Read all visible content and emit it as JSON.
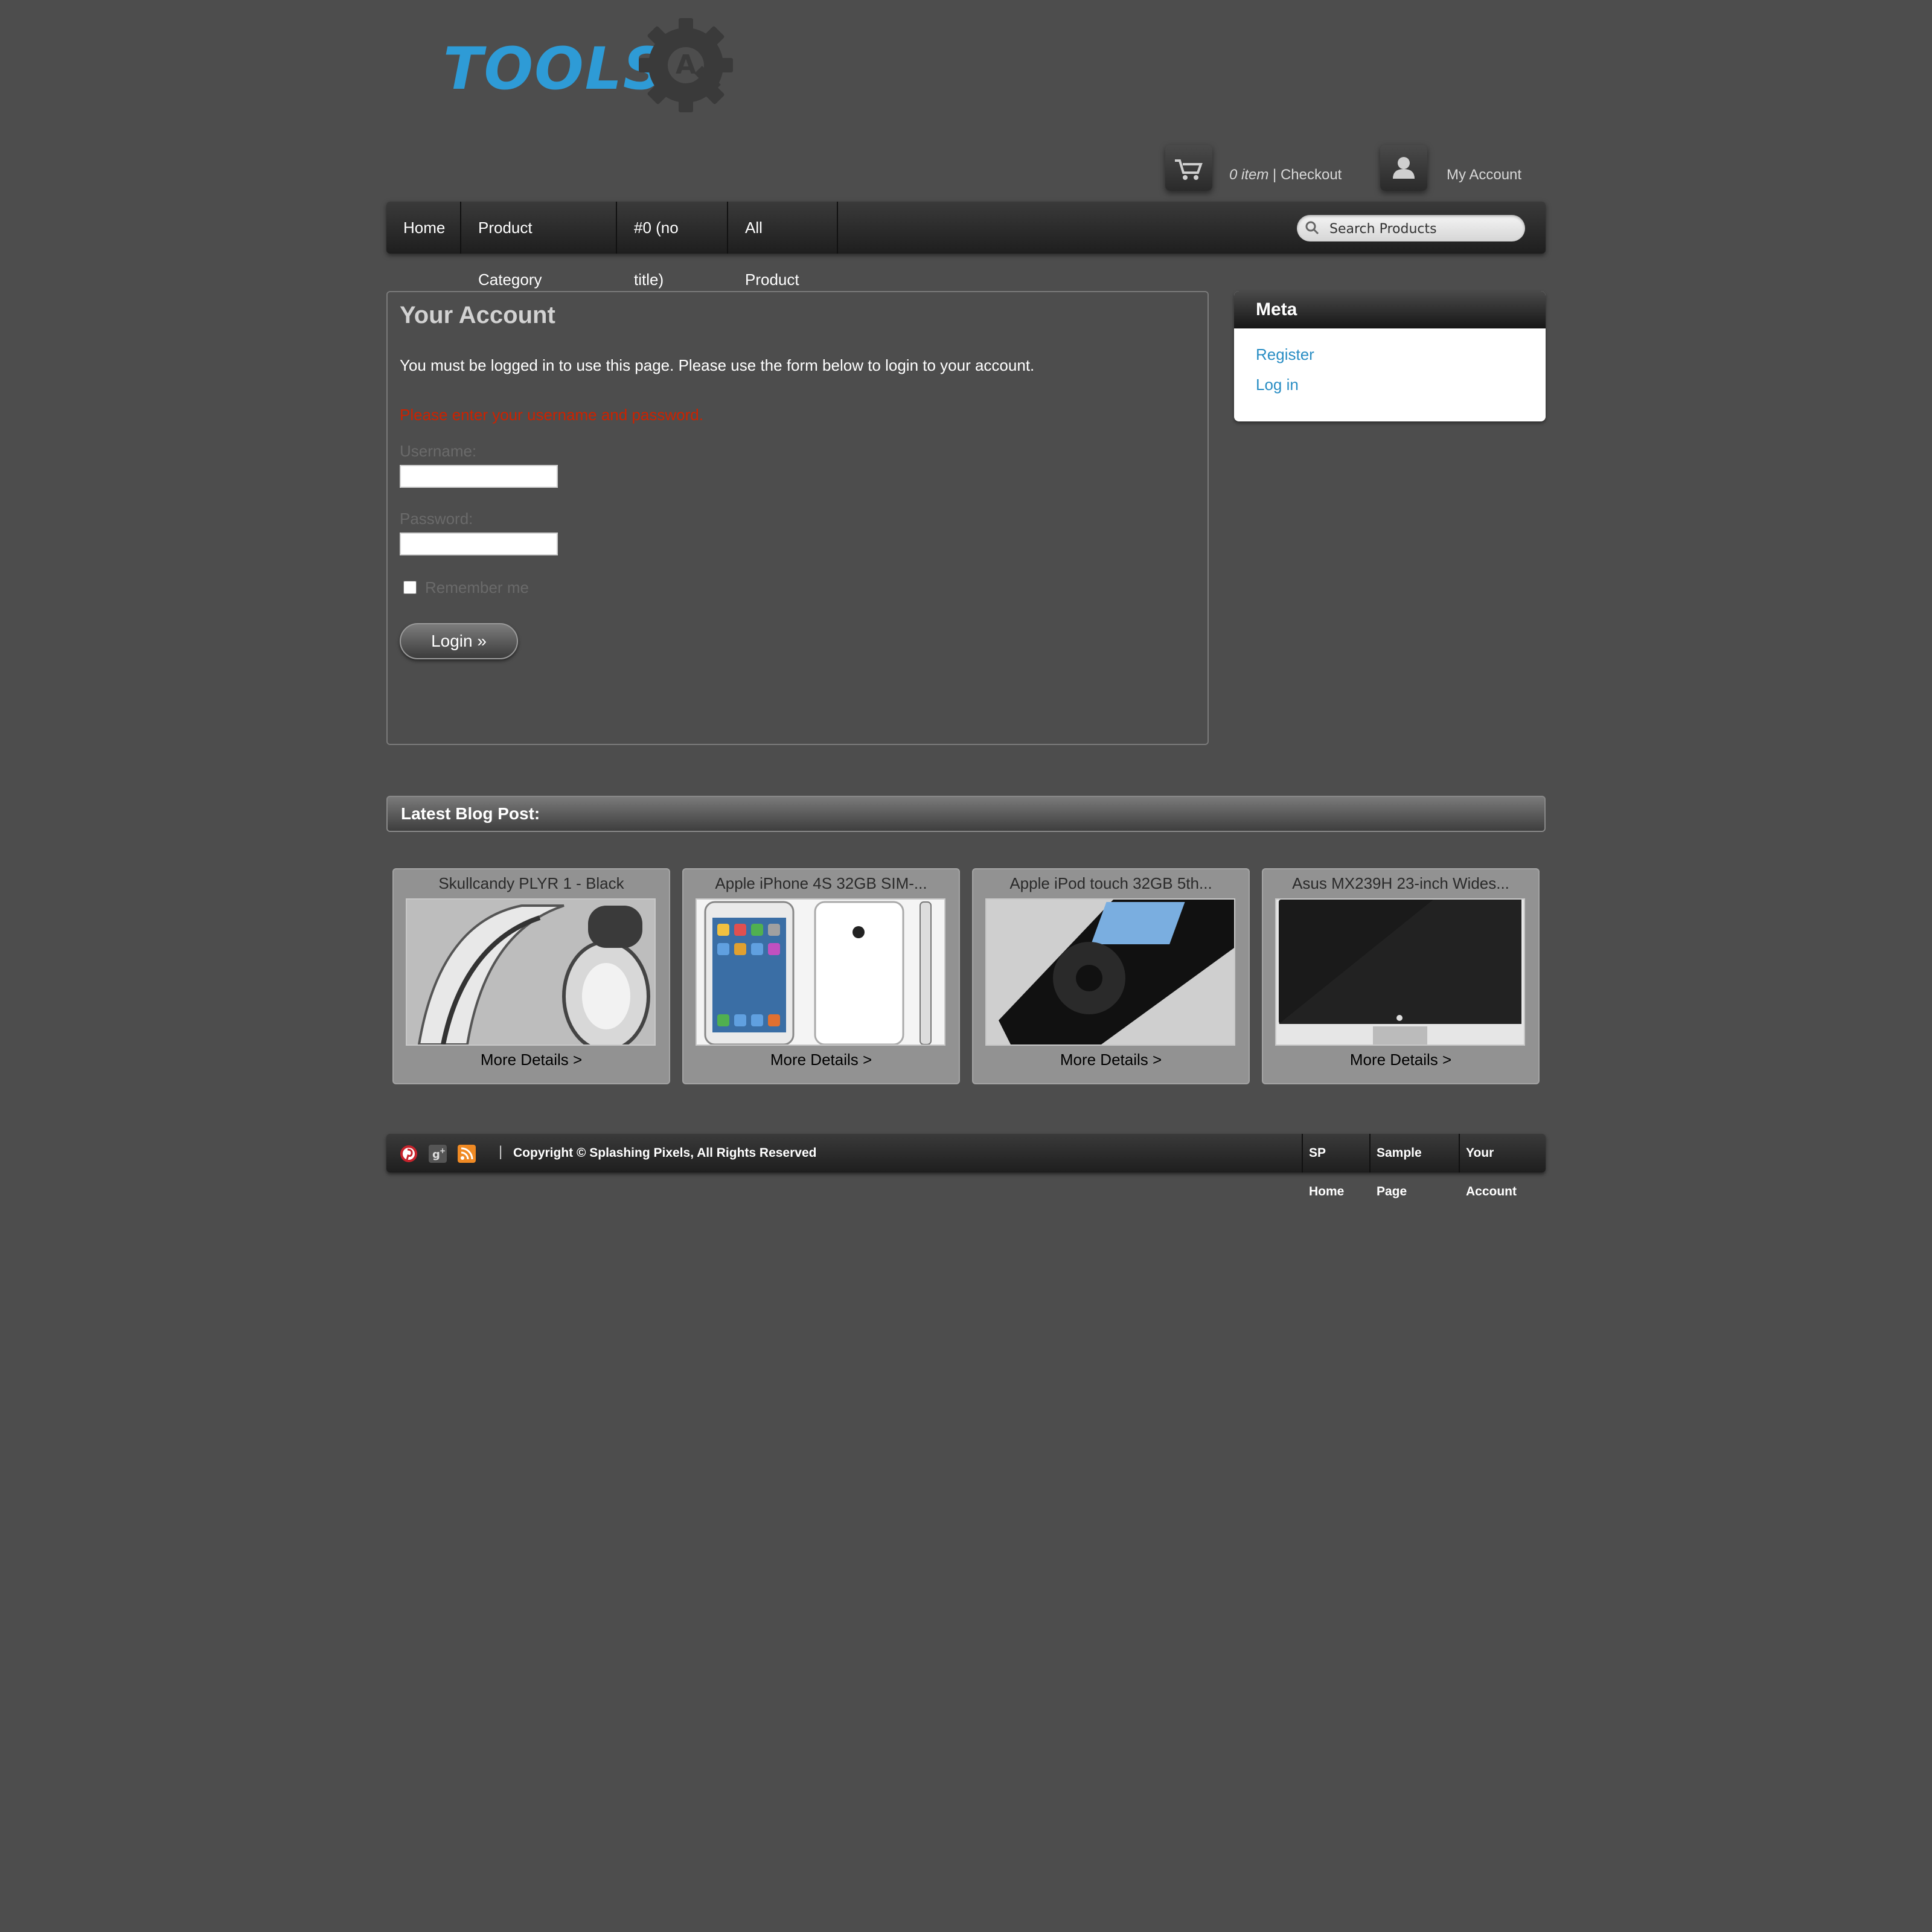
{
  "header": {
    "logo_text": "TOOLS",
    "logo_badge_letter": "A",
    "cart_count": "0 item",
    "cart_sep": " | ",
    "checkout_label": "Checkout",
    "my_account_label": "My Account"
  },
  "nav": {
    "items": [
      {
        "label": "Home"
      },
      {
        "label": "Product Category"
      },
      {
        "label": "#0 (no title)"
      },
      {
        "label": "All Product"
      }
    ],
    "search_placeholder": "Search Products"
  },
  "account": {
    "title": "Your Account",
    "message": "You must be logged in to use this page. Please use the form below to login to your account.",
    "error": "Please enter your username and password.",
    "username_label": "Username:",
    "password_label": "Password:",
    "remember_label": "Remember me",
    "login_button": "Login »"
  },
  "meta": {
    "title": "Meta",
    "links": [
      {
        "label": "Register"
      },
      {
        "label": "Log in"
      }
    ]
  },
  "blog": {
    "title": "Latest Blog Post:",
    "products": [
      {
        "title": "Skullcandy PLYR 1 - Black",
        "more": "More Details >"
      },
      {
        "title": "Apple iPhone 4S 32GB SIM-...",
        "more": "More Details >"
      },
      {
        "title": "Apple iPod touch 32GB 5th...",
        "more": "More Details >"
      },
      {
        "title": "Asus MX239H 23-inch Wides...",
        "more": "More Details >"
      }
    ]
  },
  "footer": {
    "social": [
      "pinterest-icon",
      "google-plus-icon",
      "rss-icon"
    ],
    "separator": "|",
    "copyright": "Copyright © Splashing Pixels, All Rights Reserved",
    "links": [
      {
        "label": "SP Home"
      },
      {
        "label": "Sample Page"
      },
      {
        "label": "Your Account"
      }
    ]
  },
  "colors": {
    "background": "#4d4d4d",
    "logo_blue": "#2e9bd6",
    "link_blue": "#2a8ec4",
    "error_red": "#cc2200"
  }
}
